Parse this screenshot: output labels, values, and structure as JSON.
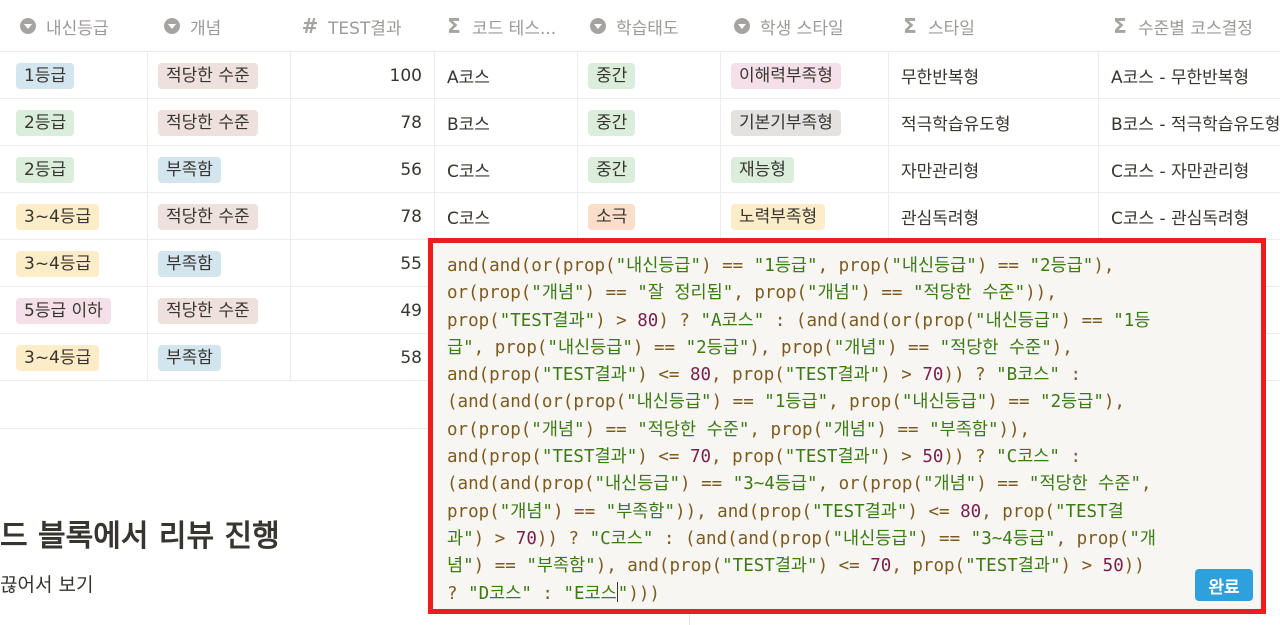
{
  "headers": [
    {
      "icon": "select-icon",
      "label": "내신등급"
    },
    {
      "icon": "select-icon",
      "label": "개념"
    },
    {
      "icon": "number-icon",
      "label": "TEST결과"
    },
    {
      "icon": "sigma-icon",
      "label": "코드 테스..."
    },
    {
      "icon": "select-icon",
      "label": "학습태도"
    },
    {
      "icon": "select-icon",
      "label": "학생 스타일"
    },
    {
      "icon": "sigma-icon",
      "label": "스타일"
    },
    {
      "icon": "sigma-icon",
      "label": "수준별 코스결정"
    }
  ],
  "rows": [
    {
      "grade": "1등급",
      "concept": "적당한 수준",
      "test": "100",
      "code": "A코스",
      "attitude": "중간",
      "student_style": "이해력부족형",
      "style": "무한반복형",
      "course": "A코스 - 무한반복형"
    },
    {
      "grade": "2등급",
      "concept": "적당한 수준",
      "test": "78",
      "code": "B코스",
      "attitude": "중간",
      "student_style": "기본기부족형",
      "style": "적극학습유도형",
      "course": "B코스 - 적극학습유도형"
    },
    {
      "grade": "2등급",
      "concept": "부족함",
      "test": "56",
      "code": "C코스",
      "attitude": "중간",
      "student_style": "재능형",
      "style": "자만관리형",
      "course": "C코스 - 자만관리형"
    },
    {
      "grade": "3~4등급",
      "concept": "적당한 수준",
      "test": "78",
      "code": "C코스",
      "attitude": "소극",
      "student_style": "노력부족형",
      "style": "관심독려형",
      "course": "C코스 - 관심독려형"
    },
    {
      "grade": "3~4등급",
      "concept": "부족함",
      "test": "55"
    },
    {
      "grade": "5등급 이하",
      "concept": "적당한 수준",
      "test": "49"
    },
    {
      "grade": "3~4등급",
      "concept": "부족함",
      "test": "58"
    }
  ],
  "tag_colors": {
    "1등급": "#d3e5ef",
    "2등급": "#dbeddb",
    "3~4등급": "#fdecc8",
    "5등급 이하": "#f5e0e9",
    "적당한 수준": "#eee0da",
    "부족함": "#d3e5ef",
    "중간": "#dbeddb",
    "소극": "#fadec9",
    "이해력부족형": "#f5e0e9",
    "기본기부족형": "#e3e2e0",
    "재능형": "#dbeddb",
    "노력부족형": "#fdecc8"
  },
  "page": {
    "heading": "드 블록에서 리뷰 진행",
    "subtext": "끊어서 보기"
  },
  "editor": {
    "formula_lines": [
      [
        [
          "k",
          "and(and(or(prop("
        ],
        [
          "s",
          "\"내신등급\""
        ],
        [
          "k",
          ") == "
        ],
        [
          "s",
          "\"1등급\""
        ],
        [
          "k",
          ", prop("
        ],
        [
          "s",
          "\"내신등급\""
        ],
        [
          "k",
          ") == "
        ],
        [
          "s",
          "\"2등급\""
        ],
        [
          "k",
          "),"
        ]
      ],
      [
        [
          "k",
          "or(prop("
        ],
        [
          "s",
          "\"개념\""
        ],
        [
          "k",
          ") == "
        ],
        [
          "s",
          "\"잘 정리됨\""
        ],
        [
          "k",
          ", prop("
        ],
        [
          "s",
          "\"개념\""
        ],
        [
          "k",
          ") == "
        ],
        [
          "s",
          "\"적당한 수준\""
        ],
        [
          "k",
          ")),"
        ]
      ],
      [
        [
          "k",
          "prop("
        ],
        [
          "s",
          "\"TEST결과\""
        ],
        [
          "k",
          ") > "
        ],
        [
          "n",
          "80"
        ],
        [
          "k",
          ") ? "
        ],
        [
          "s",
          "\"A코스\""
        ],
        [
          "k",
          " : (and(and(or(prop("
        ],
        [
          "s",
          "\"내신등급\""
        ],
        [
          "k",
          ") == "
        ],
        [
          "s",
          "\"1등"
        ]
      ],
      [
        [
          "s",
          "급\""
        ],
        [
          "k",
          ", prop("
        ],
        [
          "s",
          "\"내신등급\""
        ],
        [
          "k",
          ") == "
        ],
        [
          "s",
          "\"2등급\""
        ],
        [
          "k",
          "), prop("
        ],
        [
          "s",
          "\"개념\""
        ],
        [
          "k",
          ") == "
        ],
        [
          "s",
          "\"적당한 수준\""
        ],
        [
          "k",
          "),"
        ]
      ],
      [
        [
          "k",
          "and(prop("
        ],
        [
          "s",
          "\"TEST결과\""
        ],
        [
          "k",
          ") <= "
        ],
        [
          "n",
          "80"
        ],
        [
          "k",
          ", prop("
        ],
        [
          "s",
          "\"TEST결과\""
        ],
        [
          "k",
          ") > "
        ],
        [
          "n",
          "70"
        ],
        [
          "k",
          ")) ? "
        ],
        [
          "s",
          "\"B코스\""
        ],
        [
          "k",
          " :"
        ]
      ],
      [
        [
          "k",
          "(and(and(or(prop("
        ],
        [
          "s",
          "\"내신등급\""
        ],
        [
          "k",
          ") == "
        ],
        [
          "s",
          "\"1등급\""
        ],
        [
          "k",
          ", prop("
        ],
        [
          "s",
          "\"내신등급\""
        ],
        [
          "k",
          ") == "
        ],
        [
          "s",
          "\"2등급\""
        ],
        [
          "k",
          "),"
        ]
      ],
      [
        [
          "k",
          "or(prop("
        ],
        [
          "s",
          "\"개념\""
        ],
        [
          "k",
          ") == "
        ],
        [
          "s",
          "\"적당한 수준\""
        ],
        [
          "k",
          ", prop("
        ],
        [
          "s",
          "\"개념\""
        ],
        [
          "k",
          ") == "
        ],
        [
          "s",
          "\"부족함\""
        ],
        [
          "k",
          ")),"
        ]
      ],
      [
        [
          "k",
          "and(prop("
        ],
        [
          "s",
          "\"TEST결과\""
        ],
        [
          "k",
          ") <= "
        ],
        [
          "n",
          "70"
        ],
        [
          "k",
          ", prop("
        ],
        [
          "s",
          "\"TEST결과\""
        ],
        [
          "k",
          ") > "
        ],
        [
          "n",
          "50"
        ],
        [
          "k",
          ")) ? "
        ],
        [
          "s",
          "\"C코스\""
        ],
        [
          "k",
          " :"
        ]
      ],
      [
        [
          "k",
          "(and(and(prop("
        ],
        [
          "s",
          "\"내신등급\""
        ],
        [
          "k",
          ") == "
        ],
        [
          "s",
          "\"3~4등급\""
        ],
        [
          "k",
          ", or(prop("
        ],
        [
          "s",
          "\"개념\""
        ],
        [
          "k",
          ") == "
        ],
        [
          "s",
          "\"적당한 수준\""
        ],
        [
          "k",
          ","
        ]
      ],
      [
        [
          "k",
          "prop("
        ],
        [
          "s",
          "\"개념\""
        ],
        [
          "k",
          ") == "
        ],
        [
          "s",
          "\"부족함\""
        ],
        [
          "k",
          ")), and(prop("
        ],
        [
          "s",
          "\"TEST결과\""
        ],
        [
          "k",
          ") <= "
        ],
        [
          "n",
          "80"
        ],
        [
          "k",
          ", prop("
        ],
        [
          "s",
          "\"TEST결"
        ]
      ],
      [
        [
          "s",
          "과\""
        ],
        [
          "k",
          ") > "
        ],
        [
          "n",
          "70"
        ],
        [
          "k",
          ")) ? "
        ],
        [
          "s",
          "\"C코스\""
        ],
        [
          "k",
          " : (and(and(prop("
        ],
        [
          "s",
          "\"내신등급\""
        ],
        [
          "k",
          ") == "
        ],
        [
          "s",
          "\"3~4등급\""
        ],
        [
          "k",
          ", prop("
        ],
        [
          "s",
          "\"개"
        ]
      ],
      [
        [
          "s",
          "념\""
        ],
        [
          "k",
          ") == "
        ],
        [
          "s",
          "\"부족함\""
        ],
        [
          "k",
          "), and(prop("
        ],
        [
          "s",
          "\"TEST결과\""
        ],
        [
          "k",
          ") <= "
        ],
        [
          "n",
          "70"
        ],
        [
          "k",
          ", prop("
        ],
        [
          "s",
          "\"TEST결과\""
        ],
        [
          "k",
          ") > "
        ],
        [
          "n",
          "50"
        ],
        [
          "k",
          "))"
        ]
      ],
      [
        [
          "k",
          "? "
        ],
        [
          "s",
          "\"D코스\""
        ],
        [
          "k",
          " : "
        ],
        [
          "s",
          "\"E코스"
        ],
        [
          "c",
          ""
        ],
        [
          "s",
          "\""
        ],
        [
          "k",
          ")))"
        ]
      ]
    ],
    "done_label": "완료"
  }
}
